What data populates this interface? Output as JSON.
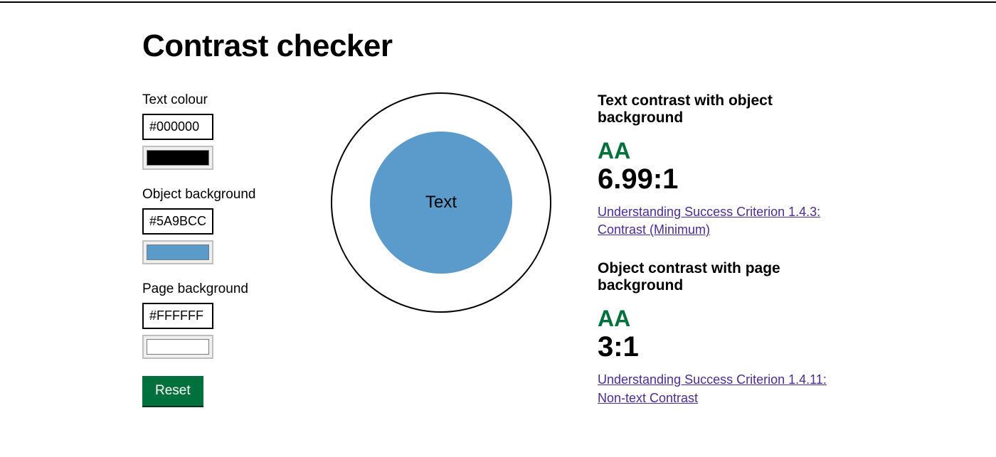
{
  "title": "Contrast checker",
  "controls": {
    "text_colour": {
      "label": "Text colour",
      "value": "#000000",
      "swatch": "#000000"
    },
    "object_bg": {
      "label": "Object background",
      "value": "#5A9BCC",
      "swatch": "#5A9BCC"
    },
    "page_bg": {
      "label": "Page background",
      "value": "#FFFFFF",
      "swatch": "#FFFFFF"
    },
    "reset_label": "Reset"
  },
  "preview": {
    "text": "Text",
    "outer_bg": "#FFFFFF",
    "inner_bg": "#5A9BCC",
    "text_color": "#000000"
  },
  "results": {
    "text_obj": {
      "heading": "Text contrast with object background",
      "rating": "AA",
      "ratio": "6.99:1",
      "link_text": "Understanding Success Criterion 1.4.3: Contrast (Minimum)"
    },
    "obj_page": {
      "heading": "Object contrast with page background",
      "rating": "AA",
      "ratio": "3:1",
      "link_text": "Understanding Success Criterion 1.4.11: Non-text Contrast"
    }
  }
}
